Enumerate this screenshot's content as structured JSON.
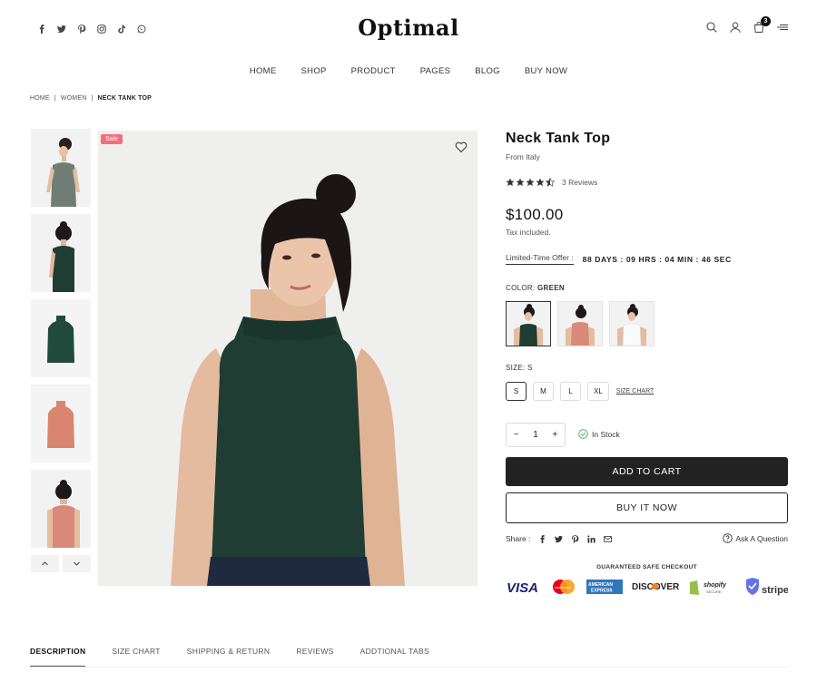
{
  "header": {
    "logo": "Optimal",
    "social": [
      "facebook",
      "twitter",
      "pinterest",
      "instagram",
      "tiktok",
      "whatsapp"
    ],
    "cart_count": "3"
  },
  "nav": {
    "items": [
      "HOME",
      "SHOP",
      "PRODUCT",
      "PAGES",
      "BLOG",
      "BUY NOW"
    ]
  },
  "breadcrumb": {
    "items": [
      "HOME",
      "WOMEN"
    ],
    "current": "NECK TANK TOP",
    "separator": "|"
  },
  "gallery": {
    "sale_badge": "Sale",
    "thumbnail_count": 5
  },
  "product": {
    "title": "Neck Tank Top",
    "subtitle": "From Italy",
    "rating": 4.5,
    "reviews": "3 Reviews",
    "price": "$100.00",
    "tax_note": "Tax included.",
    "offer_label": "Limited-Time Offer :",
    "countdown": "88 DAYS : 09 HRS : 04 MIN : 46 SEC",
    "color_label": "COLOR:",
    "color_value": "GREEN",
    "colors": [
      "green",
      "coral",
      "white"
    ],
    "size_label": "SIZE: S",
    "sizes": [
      "S",
      "M",
      "L",
      "XL"
    ],
    "selected_size": "S",
    "size_chart_link": "SIZE CHART",
    "qty_minus": "−",
    "qty_value": "1",
    "qty_plus": "+",
    "stock": "In Stock",
    "add_to_cart": "ADD TO CART",
    "buy_now": "BUY IT NOW",
    "share_label": "Share :",
    "ask_question": "Ask A Question",
    "checkout_label": "GUARANTEED SAFE CHECKOUT",
    "payment_methods": [
      "VISA",
      "mastercard",
      "AMERICAN EXPRESS",
      "DISCOVER",
      "shopify SECURE",
      "stripe"
    ]
  },
  "tabs": [
    "DESCRIPTION",
    "SIZE CHART",
    "SHIPPING & RETURN",
    "REVIEWS",
    "ADDTIONAL TABS"
  ],
  "colors": {
    "accent": "#222222",
    "sale": "#f26d7d",
    "top_green": "#1f3d33",
    "top_coral": "#d98570",
    "stock_green": "#3bab4f",
    "visa": "#1a1f71"
  }
}
